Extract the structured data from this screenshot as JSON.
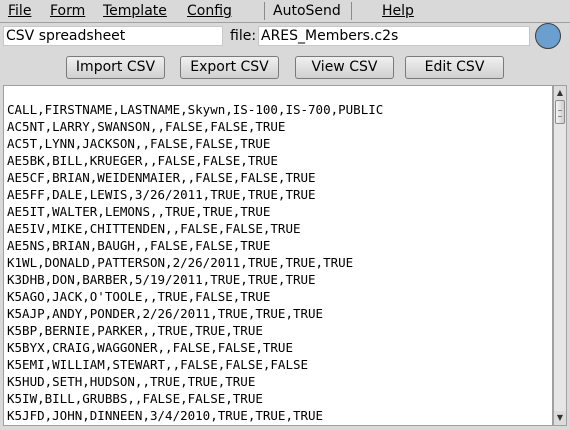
{
  "menubar": {
    "items": [
      {
        "label": "File"
      },
      {
        "label": "Form"
      },
      {
        "label": "Template"
      },
      {
        "label": "Config"
      },
      {
        "label": "AutoSend"
      },
      {
        "label": "Help"
      }
    ]
  },
  "form": {
    "description": "CSV spreadsheet",
    "file_label": "file:",
    "file_name": "ARES_Members.c2s",
    "status_color": "#6b9fd0"
  },
  "toolbar": {
    "import_label": "Import CSV",
    "export_label": "Export CSV",
    "view_label": "View CSV",
    "edit_label": "Edit CSV"
  },
  "csv": {
    "lines": [
      "CALL,FIRSTNAME,LASTNAME,Skywn,IS-100,IS-700,PUBLIC",
      "AC5NT,LARRY,SWANSON,,FALSE,FALSE,TRUE",
      "AC5T,LYNN,JACKSON,,FALSE,FALSE,TRUE",
      "AE5BK,BILL,KRUEGER,,FALSE,FALSE,TRUE",
      "AE5CF,BRIAN,WEIDENMAIER,,FALSE,FALSE,TRUE",
      "AE5FF,DALE,LEWIS,3/26/2011,TRUE,TRUE,TRUE",
      "AE5IT,WALTER,LEMONS,,TRUE,TRUE,TRUE",
      "AE5IV,MIKE,CHITTENDEN,,FALSE,FALSE,TRUE",
      "AE5NS,BRIAN,BAUGH,,FALSE,FALSE,TRUE",
      "K1WL,DONALD,PATTERSON,2/26/2011,TRUE,TRUE,TRUE",
      "K3DHB,DON,BARBER,5/19/2011,TRUE,TRUE,TRUE",
      "K5AGO,JACK,O'TOOLE,,TRUE,FALSE,TRUE",
      "K5AJP,ANDY,PONDER,2/26/2011,TRUE,TRUE,TRUE",
      "K5BP,BERNIE,PARKER,,TRUE,TRUE,TRUE",
      "K5BYX,CRAIG,WAGGONER,,FALSE,FALSE,TRUE",
      "K5EMI,WILLIAM,STEWART,,FALSE,FALSE,FALSE",
      "K5HUD,SETH,HUDSON,,TRUE,TRUE,TRUE",
      "K5IW,BILL,GRUBBS,,FALSE,FALSE,TRUE",
      "K5JFD,JOHN,DINNEEN,3/4/2010,TRUE,TRUE,TRUE"
    ]
  },
  "scrollbar": {
    "up_glyph": "▲",
    "down_glyph": "▼"
  }
}
